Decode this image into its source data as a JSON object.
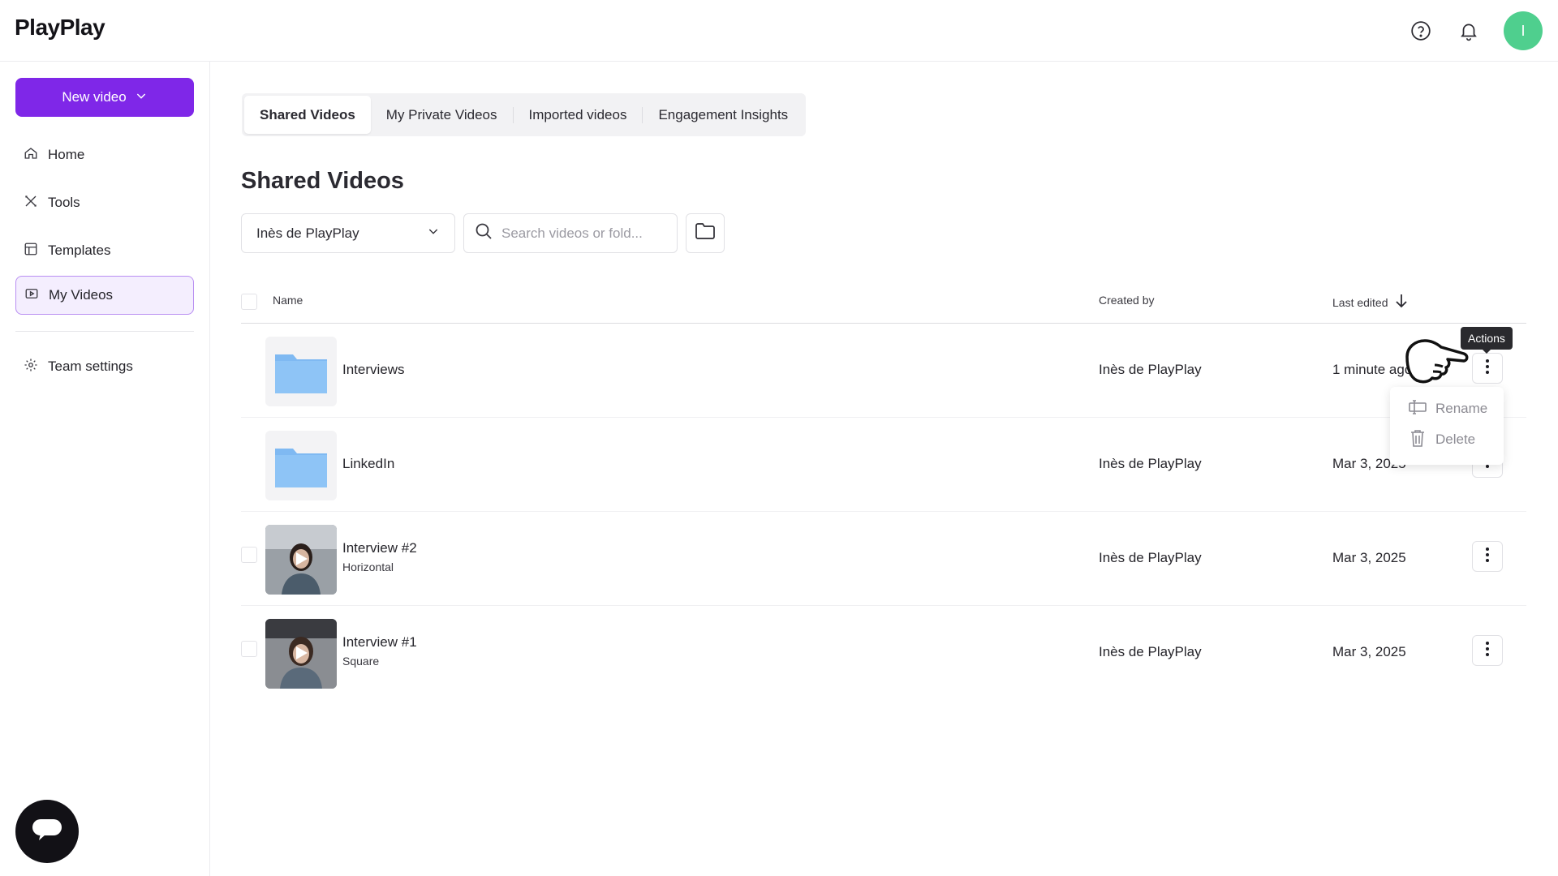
{
  "app": {
    "logo": "PlayPlay",
    "avatar_initial": "I",
    "accent": "#7f27e8"
  },
  "sidebar": {
    "new_video_label": "New video",
    "items": [
      {
        "label": "Home",
        "icon": "home-icon"
      },
      {
        "label": "Tools",
        "icon": "tools-icon"
      },
      {
        "label": "Templates",
        "icon": "templates-icon"
      },
      {
        "label": "My Videos",
        "icon": "video-icon",
        "active": true
      },
      {
        "label": "Team settings",
        "icon": "gear-icon"
      }
    ]
  },
  "tabs": [
    {
      "label": "Shared Videos",
      "active": true
    },
    {
      "label": "My Private Videos"
    },
    {
      "label": "Imported videos"
    },
    {
      "label": "Engagement Insights"
    }
  ],
  "page_title": "Shared Videos",
  "filters": {
    "owner": "Inès de PlayPlay",
    "search_placeholder": "Search videos or fold..."
  },
  "table": {
    "headers": {
      "name": "Name",
      "created_by": "Created by",
      "last_edited": "Last edited"
    },
    "rows": [
      {
        "type": "folder",
        "name": "Interviews",
        "sub": "",
        "created_by": "Inès de PlayPlay",
        "last_edited": "1 minute ago"
      },
      {
        "type": "folder",
        "name": "LinkedIn",
        "sub": "",
        "created_by": "Inès de PlayPlay",
        "last_edited": "Mar 3, 2025"
      },
      {
        "type": "video",
        "name": "Interview #2",
        "sub": "Horizontal",
        "created_by": "Inès de PlayPlay",
        "last_edited": "Mar 3, 2025"
      },
      {
        "type": "video",
        "name": "Interview #1",
        "sub": "Square",
        "created_by": "Inès de PlayPlay",
        "last_edited": "Mar 3, 2025"
      }
    ]
  },
  "tooltip": "Actions",
  "context_menu": [
    {
      "label": "Rename",
      "icon": "rename-icon"
    },
    {
      "label": "Delete",
      "icon": "trash-icon"
    }
  ]
}
